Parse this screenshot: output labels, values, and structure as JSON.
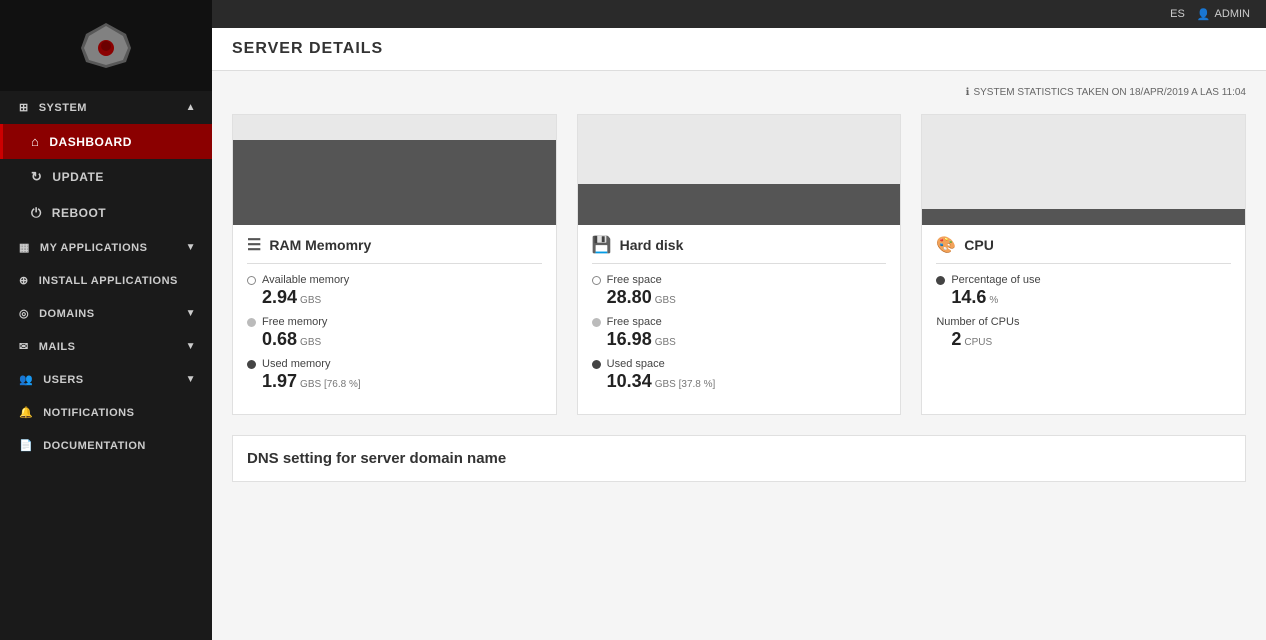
{
  "topbar": {
    "lang": "ES",
    "user_icon": "👤",
    "user_label": "ADMIN"
  },
  "page": {
    "title": "SERVER DETAILS"
  },
  "stats_timestamp": "SYSTEM STATISTICS TAKEN ON 18/APR/2019 A LAS 11:04",
  "sidebar": {
    "sections": [
      {
        "id": "system",
        "label": "SYSTEM",
        "icon": "⊞",
        "expanded": true,
        "items": [
          {
            "id": "dashboard",
            "label": "DASHBOARD",
            "icon": "⌂",
            "active": true
          },
          {
            "id": "update",
            "label": "UPDATE",
            "icon": "↻"
          },
          {
            "id": "reboot",
            "label": "REBOOT",
            "icon": "⏻"
          }
        ]
      },
      {
        "id": "my-applications",
        "label": "MY APPLICATIONS",
        "icon": "▦",
        "expanded": false,
        "items": []
      },
      {
        "id": "install-applications",
        "label": "INSTALL APPLICATIONS",
        "icon": "⊕",
        "expanded": false,
        "items": []
      },
      {
        "id": "domains",
        "label": "DOMAINS",
        "icon": "◎",
        "expanded": false,
        "items": []
      },
      {
        "id": "mails",
        "label": "MAILS",
        "icon": "✉",
        "expanded": false,
        "items": []
      },
      {
        "id": "users",
        "label": "USERS",
        "icon": "👥",
        "expanded": false,
        "items": []
      },
      {
        "id": "notifications",
        "label": "NOTIFICATIONS",
        "icon": "🔔",
        "expanded": false,
        "items": []
      },
      {
        "id": "documentation",
        "label": "DOCUMENTATION",
        "icon": "📄",
        "expanded": false,
        "items": []
      }
    ]
  },
  "ram": {
    "title": "RAM Memomry",
    "icon": "☰",
    "bar_fill_pct": 77,
    "available_label": "Available memory",
    "available_value": "2.94",
    "available_unit": "GBS",
    "free_label": "Free memory",
    "free_value": "0.68",
    "free_unit": "GBS",
    "used_label": "Used memory",
    "used_value": "1.97",
    "used_unit": "GBS [76.8 %]"
  },
  "disk": {
    "title": "Hard disk",
    "icon": "💾",
    "bar_fill_pct": 37,
    "free_space_label": "Free space",
    "free_space_value": "28.80",
    "free_space_unit": "GBS",
    "free_label": "Free space",
    "free_value": "16.98",
    "free_unit": "GBS",
    "used_label": "Used space",
    "used_value": "10.34",
    "used_unit": "GBS [37.8 %]"
  },
  "cpu": {
    "title": "CPU",
    "icon": "🎨",
    "bar_fill_pct": 15,
    "pct_label": "Percentage of use",
    "pct_value": "14.6",
    "pct_unit": "%",
    "num_label": "Number of CPUs",
    "num_value": "2",
    "num_unit": "CPUS"
  },
  "dns": {
    "title": "DNS setting for server domain name"
  }
}
